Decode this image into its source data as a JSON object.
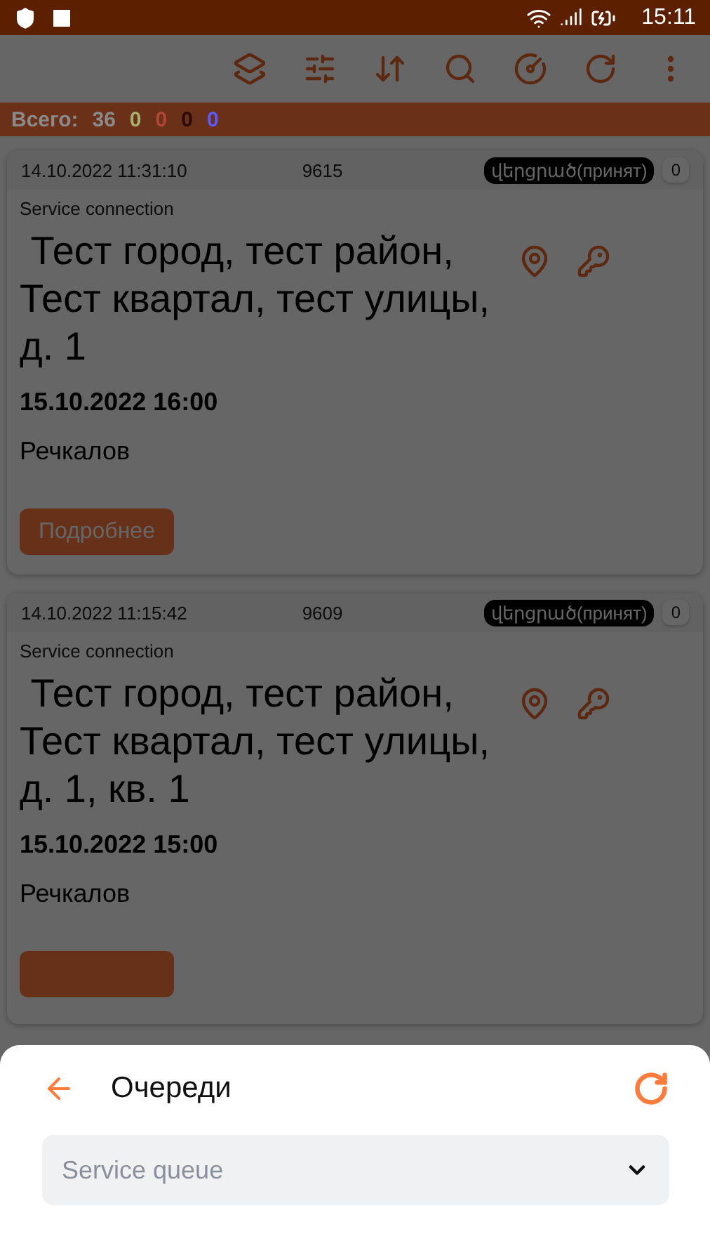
{
  "status_bar": {
    "time": "15:11"
  },
  "summary": {
    "label": "Всего:",
    "total": "36",
    "counts": [
      {
        "value": "0",
        "color": "#a8b070"
      },
      {
        "value": "0",
        "color": "#b04838"
      },
      {
        "value": "0",
        "color": "#2a0a04"
      },
      {
        "value": "0",
        "color": "#5a5aff"
      }
    ]
  },
  "cards": [
    {
      "datetime": "14.10.2022 11:31:10",
      "number": "9615",
      "status": "վերցրած(принят)",
      "comments": "0",
      "type": "Service connection",
      "address": " Тест город, тест район, Тест квартал, тест улицы, д. 1",
      "deadline": "15.10.2022 16:00",
      "assignee": "Речкалов",
      "details_button": "Подробнее"
    },
    {
      "datetime": "14.10.2022 11:15:42",
      "number": "9609",
      "status": "վերցրած(принят)",
      "comments": "0",
      "type": "Service connection",
      "address": " Тест город, тест район, Тест квартал, тест улицы, д. 1, кв. 1",
      "deadline": "15.10.2022 15:00",
      "assignee": "Речкалов"
    }
  ],
  "sheet": {
    "title": "Очереди",
    "select": {
      "placeholder": "Service queue"
    }
  }
}
